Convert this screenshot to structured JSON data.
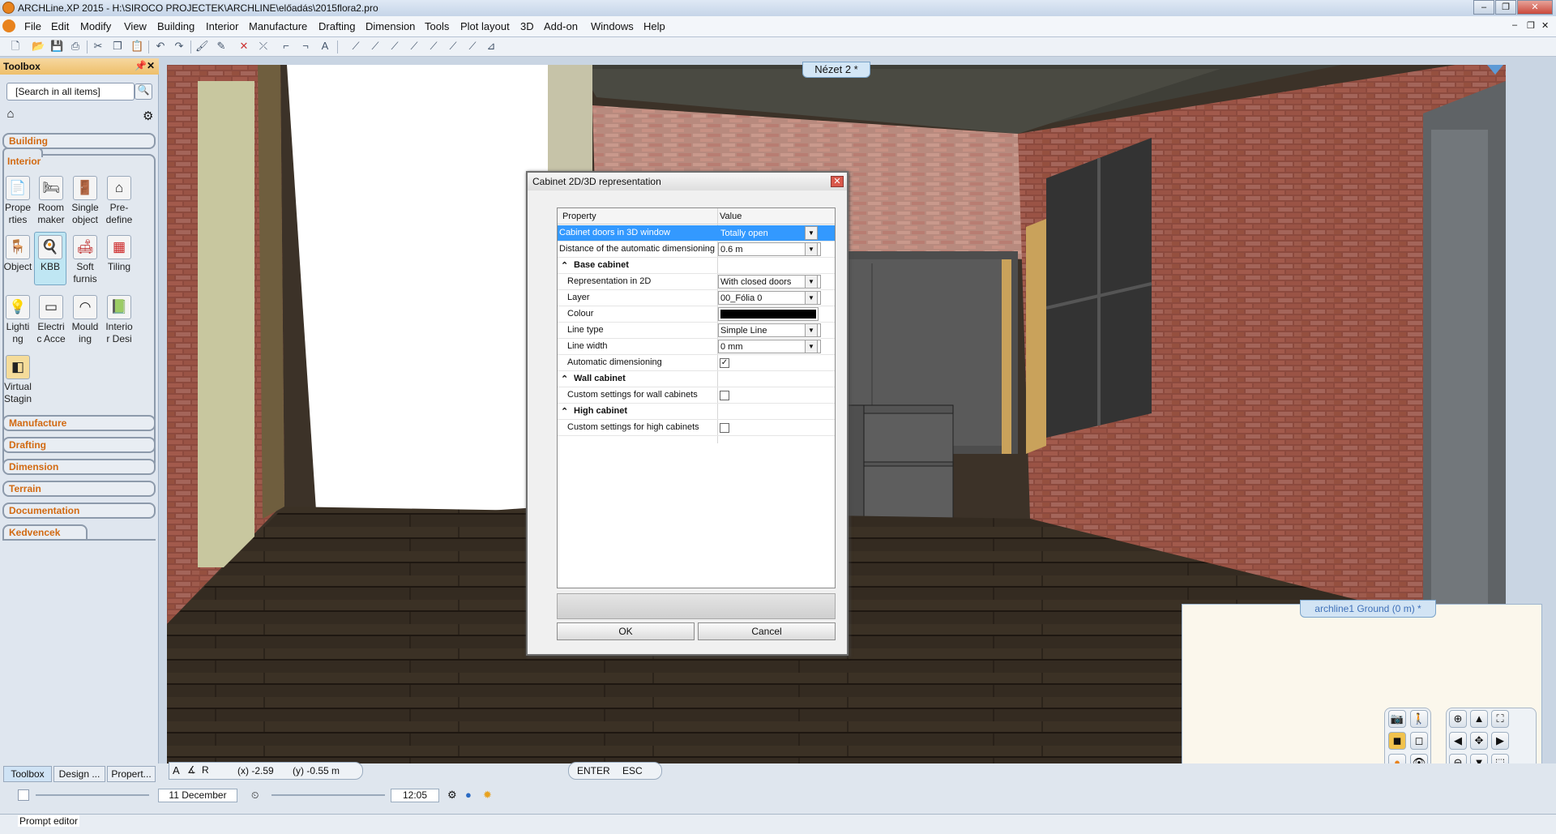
{
  "app": {
    "title": "ARCHLine.XP 2015 - H:\\SIROCO PROJECTEK\\ARCHLINE\\előadás\\2015flora2.pro"
  },
  "menu": [
    "File",
    "Edit",
    "Modify",
    "View",
    "Building",
    "Interior",
    "Manufacture",
    "Drafting",
    "Dimension",
    "Tools",
    "Plot layout",
    "3D",
    "Add-on",
    "Windows",
    "Help"
  ],
  "toolbox": {
    "title": "Toolbox",
    "search_placeholder": "[Search in all items]",
    "categories": {
      "building": "Building",
      "interior": "Interior",
      "manufacture": "Manufacture",
      "drafting": "Drafting",
      "dimension": "Dimension",
      "terrain": "Terrain",
      "documentation": "Documentation",
      "kedvencek": "Kedvencek"
    },
    "tools": [
      "Prope rties",
      "Room maker",
      "Single object",
      "Pre- define",
      "Object",
      "KBB",
      "Soft furnis",
      "Tiling",
      "Lighti ng",
      "Electri c Acce",
      "Mould ing",
      "Interio r Desi",
      "Virtual Stagin"
    ],
    "tool_icons": [
      "properties-icon",
      "room-maker-icon",
      "single-object-icon",
      "predefine-icon",
      "object-icon",
      "kbb-icon",
      "soft-furnishing-icon",
      "tiling-icon",
      "lighting-icon",
      "electric-icon",
      "moulding-icon",
      "interior-design-icon",
      "virtual-staging-icon"
    ],
    "selected_tool": "KBB"
  },
  "view": {
    "tab": "Nézet 2 *"
  },
  "dialog": {
    "title": "Cabinet 2D/3D representation",
    "headers": {
      "property": "Property",
      "value": "Value"
    },
    "rows": {
      "r1": {
        "k": "Cabinet doors in 3D window",
        "v": "Totally open"
      },
      "r2": {
        "k": "Distance of the automatic dimensioning",
        "v": "0.6 m"
      },
      "base": "Base cabinet",
      "r3": {
        "k": "Representation in 2D",
        "v": "With closed doors"
      },
      "r4": {
        "k": "Layer",
        "v": "00_Fólia 0"
      },
      "r5": {
        "k": "Colour",
        "v": ""
      },
      "r6": {
        "k": "Line type",
        "v": "Simple Line"
      },
      "r7": {
        "k": "Line width",
        "v": "0 mm"
      },
      "r8": {
        "k": "Automatic dimensioning",
        "v": "✓"
      },
      "wall": "Wall cabinet",
      "r9": {
        "k": "Custom settings for wall cabinets",
        "v": ""
      },
      "high": "High cabinet",
      "r10": {
        "k": "Custom settings for high cabinets",
        "v": ""
      }
    },
    "colour_value": "#000000",
    "ok": "OK",
    "cancel": "Cancel"
  },
  "minimap": {
    "tab": "archline1 Ground (0 m) *"
  },
  "status": {
    "tabs": [
      "Toolbox",
      "Design ...",
      "Propert..."
    ],
    "coord_x": "(x) -2.59",
    "coord_y": "(y) -0.55 m",
    "enter": "ENTER",
    "esc": "ESC",
    "date": "11 December",
    "time": "12:05",
    "prompt": "Prompt editor"
  }
}
